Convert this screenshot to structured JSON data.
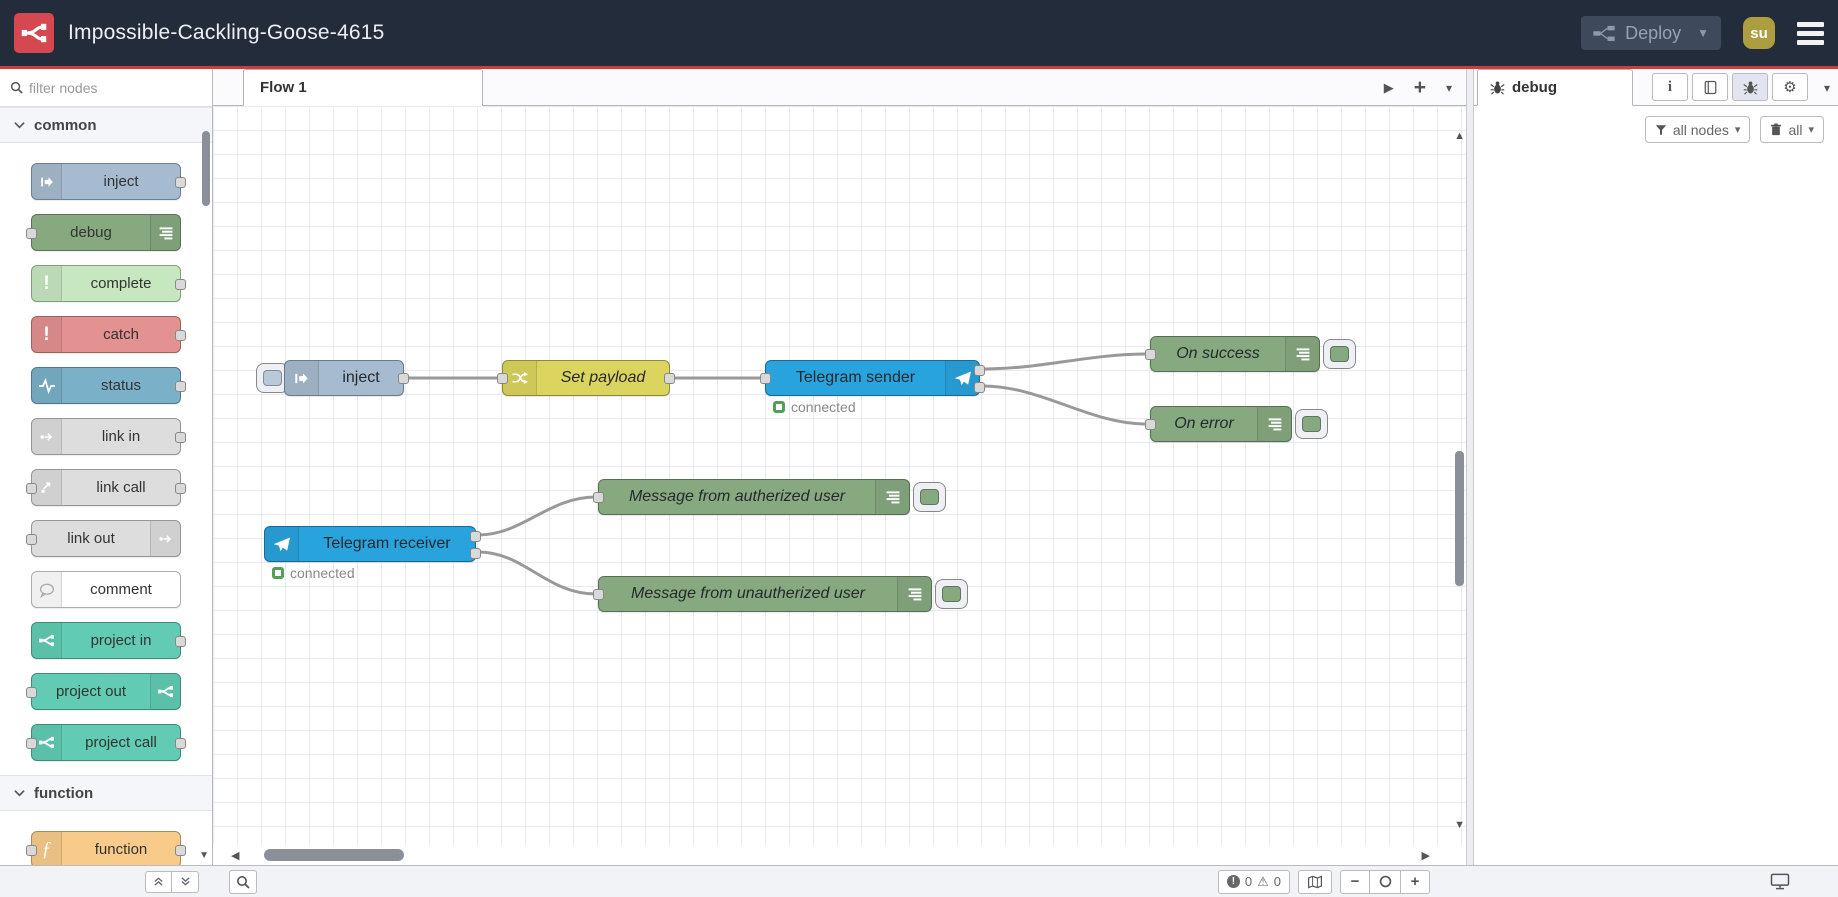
{
  "header": {
    "title": "Impossible-Cackling-Goose-4615",
    "deploy_label": "Deploy",
    "avatar_text": "su"
  },
  "palette": {
    "search_placeholder": "filter nodes",
    "categories": [
      {
        "label": "common",
        "nodes": [
          {
            "label": "inject"
          },
          {
            "label": "debug"
          },
          {
            "label": "complete"
          },
          {
            "label": "catch"
          },
          {
            "label": "status"
          },
          {
            "label": "link in"
          },
          {
            "label": "link call"
          },
          {
            "label": "link out"
          },
          {
            "label": "comment"
          },
          {
            "label": "project in"
          },
          {
            "label": "project out"
          },
          {
            "label": "project call"
          }
        ]
      },
      {
        "label": "function",
        "nodes": [
          {
            "label": "function"
          }
        ]
      }
    ]
  },
  "workspace": {
    "tab_label": "Flow 1"
  },
  "flow": {
    "nodes": [
      {
        "label": "inject"
      },
      {
        "label": "Set payload"
      },
      {
        "label": "Telegram sender",
        "status": "connected"
      },
      {
        "label": "On success"
      },
      {
        "label": "On error"
      },
      {
        "label": "Telegram receiver",
        "status": "connected"
      },
      {
        "label": "Message from autherized user"
      },
      {
        "label": "Message from unautherized user"
      }
    ]
  },
  "sidebar": {
    "tab_label": "debug",
    "filter_label": "all nodes",
    "clear_label": "all"
  },
  "footer": {
    "error_count": "0",
    "warning_count": "0"
  },
  "colors": {
    "header_bg": "#232c3a",
    "red_line": "#cf3c3c",
    "logo_red": "#d5484f",
    "deploy_bg": "#3e4a5c",
    "avatar_bg": "#ac9d41",
    "node_inject": "#a6bbcf",
    "node_debug": "#87a980",
    "node_complete": "#c7e7c0",
    "node_catch": "#e49191",
    "node_status": "#7ab1c9",
    "node_link": "#dddddd",
    "node_comment": "#ffffff",
    "node_project": "#61ccb3",
    "node_function": "#f9cb8b",
    "node_telegram": "#29a3dd",
    "node_change": "#dbd55f",
    "status_green": "#52a058",
    "wire": "#999999",
    "grid_line": "#e7e9f4"
  }
}
